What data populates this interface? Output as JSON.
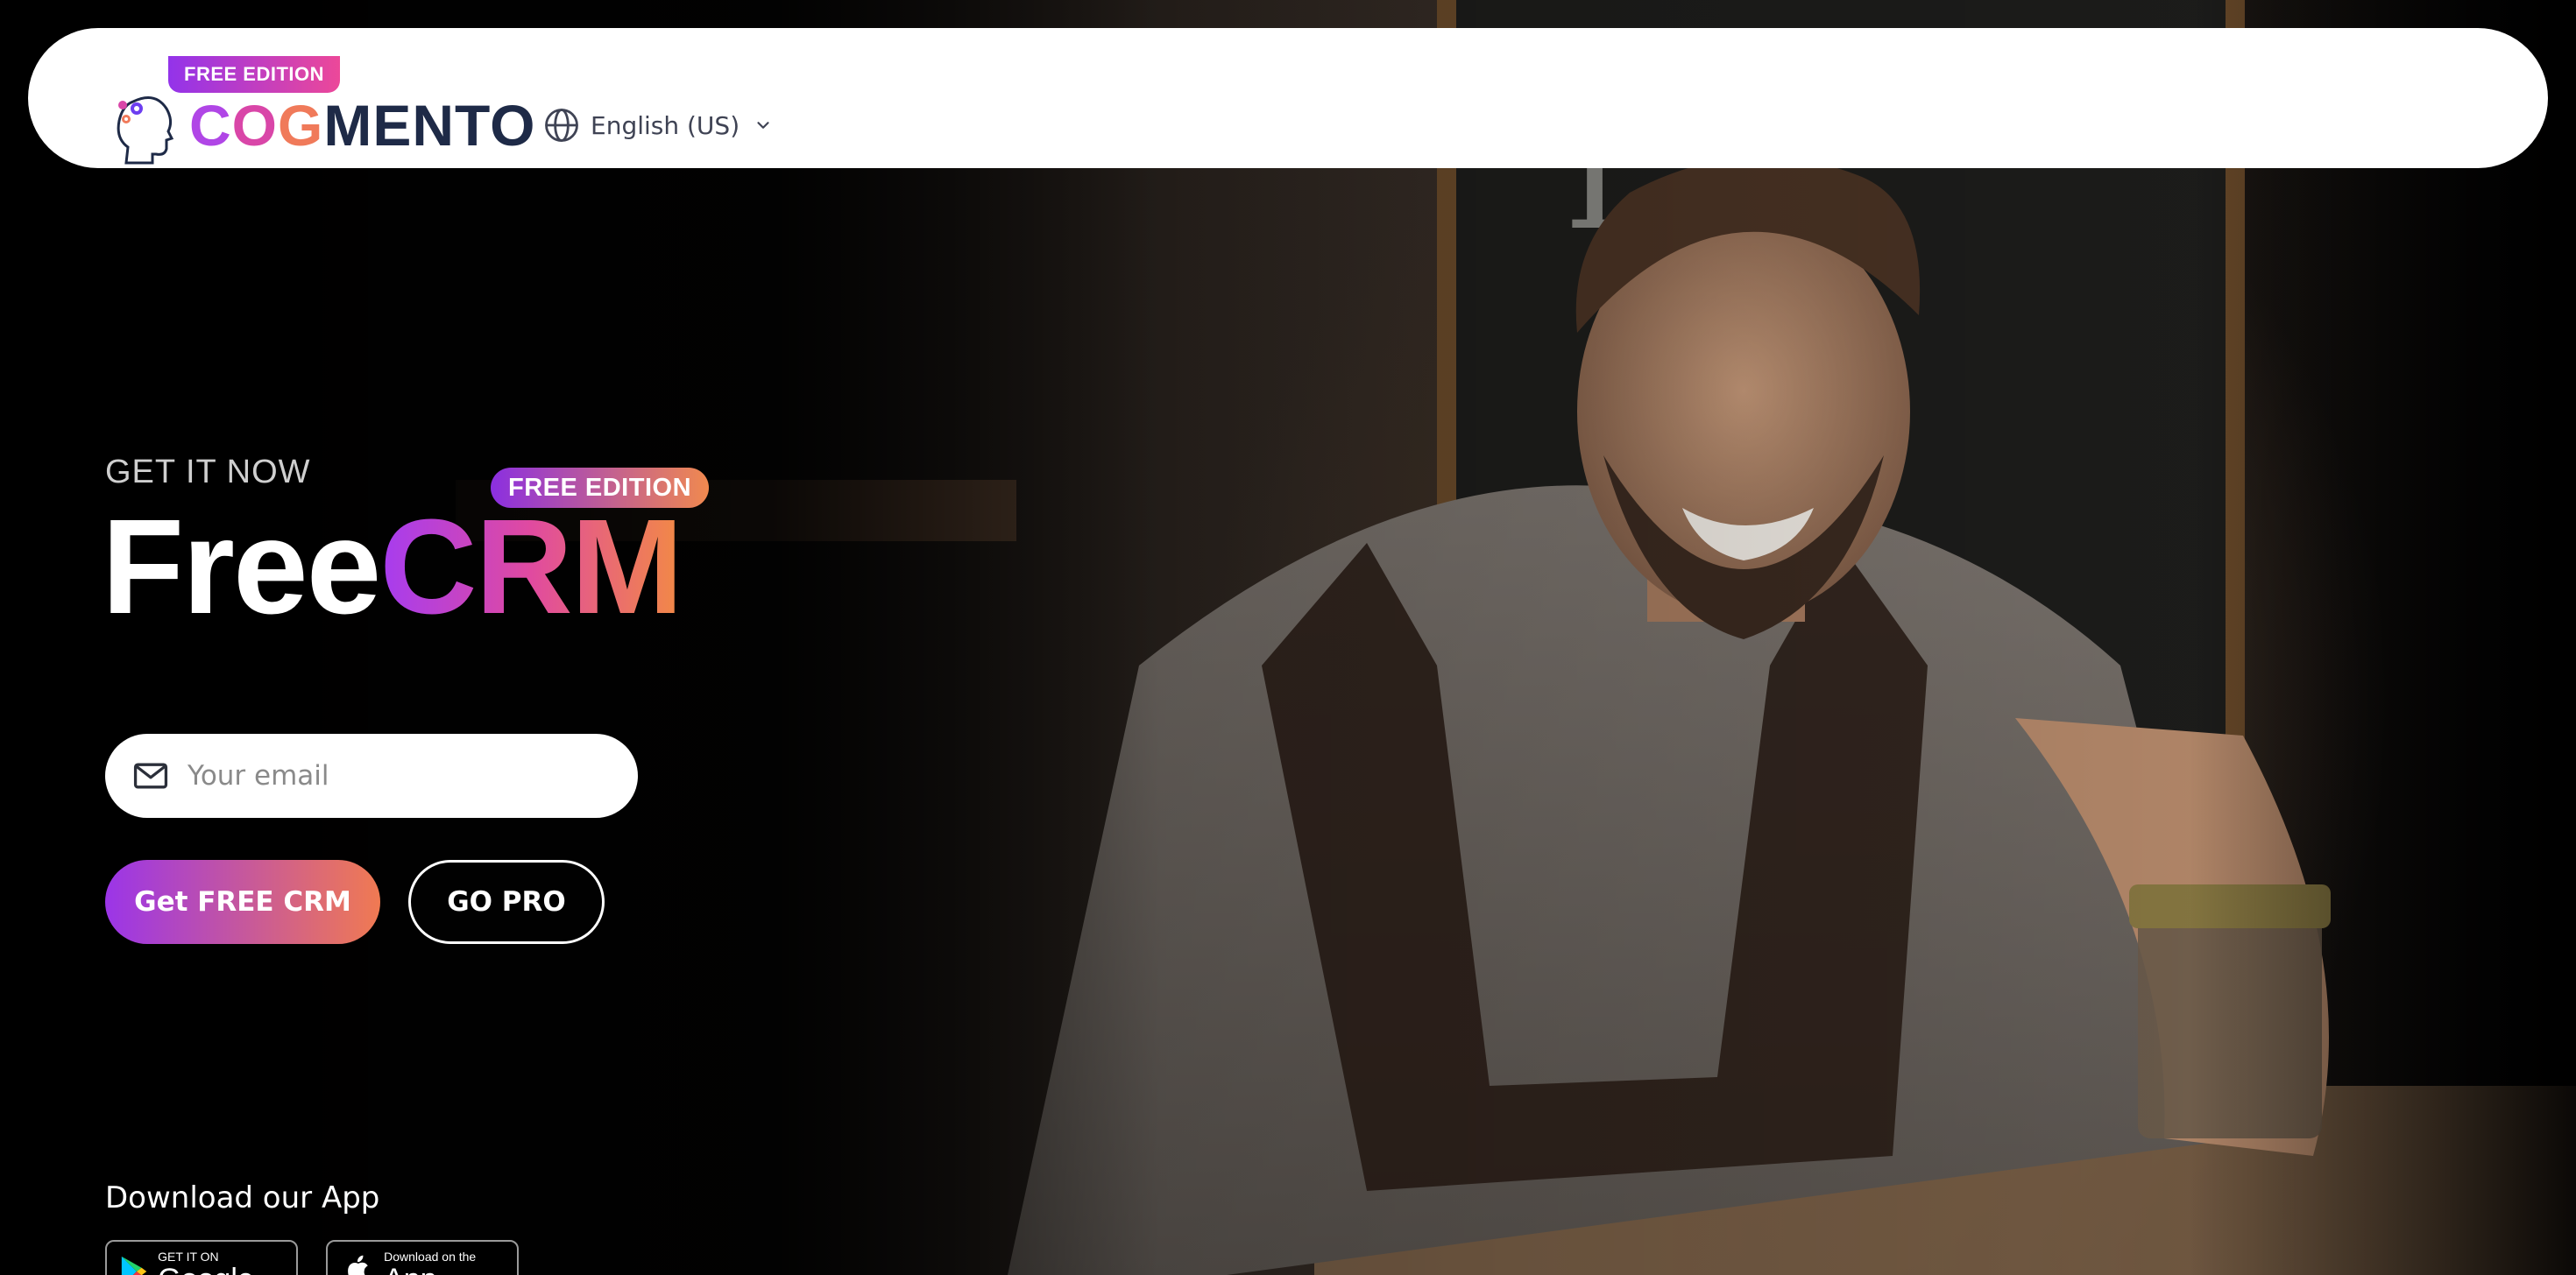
{
  "header": {
    "badge": "FREE EDITION",
    "logo": {
      "part1": "C",
      "part2": "O",
      "part3": "G",
      "part4": "MENTO"
    },
    "language": {
      "label": "English (US)",
      "icon": "globe-icon",
      "chevron": "chevron-down-icon"
    }
  },
  "hero": {
    "eyebrow": "GET IT NOW",
    "badge": "FREE EDITION",
    "title_white": "Free",
    "title_gradient": "CRM",
    "email": {
      "placeholder": "Your email",
      "value": "",
      "icon": "mail-icon"
    },
    "primary_button": "Get FREE CRM",
    "secondary_button": "GO PRO"
  },
  "apps": {
    "label": "Download our App",
    "google_play": {
      "small": "GET IT ON",
      "big": "Google Play"
    },
    "app_store": {
      "small": "Download on the",
      "big": "App Store"
    }
  },
  "colors": {
    "gradient_start": "#9b35e8",
    "gradient_mid": "#e04aa0",
    "gradient_end": "#f07a52",
    "navy": "#1e2a47"
  }
}
